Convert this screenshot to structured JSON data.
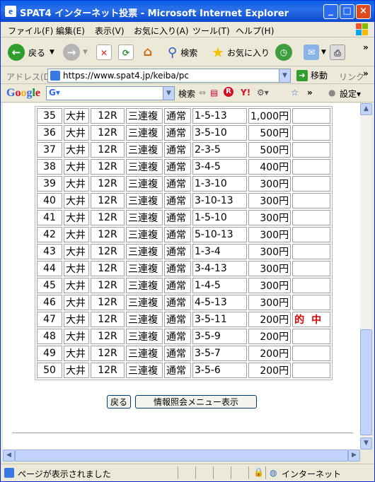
{
  "window": {
    "title": "SPAT4 インターネット投票 - Microsoft Internet Explorer"
  },
  "menu": [
    "ファイル(F)",
    "編集(E)",
    "表示(V)",
    "お気に入り(A)",
    "ツール(T)",
    "ヘルプ(H)"
  ],
  "toolbar": {
    "back": "戻る",
    "search": "検索",
    "favorites": "お気に入り"
  },
  "address": {
    "label": "アドレス(D)",
    "url": "https://www.spat4.jp/keiba/pc",
    "go": "移動",
    "links": "リンク"
  },
  "google": {
    "search": "検索",
    "settings": "設定"
  },
  "bets": [
    {
      "no": "35",
      "venue": "大井",
      "race": "12R",
      "type": "三連複",
      "mode": "通常",
      "combo": "1-5-13",
      "amount": "1,000円",
      "result": ""
    },
    {
      "no": "36",
      "venue": "大井",
      "race": "12R",
      "type": "三連複",
      "mode": "通常",
      "combo": "3-5-10",
      "amount": "500円",
      "result": ""
    },
    {
      "no": "37",
      "venue": "大井",
      "race": "12R",
      "type": "三連複",
      "mode": "通常",
      "combo": "2-3-5",
      "amount": "500円",
      "result": ""
    },
    {
      "no": "38",
      "venue": "大井",
      "race": "12R",
      "type": "三連複",
      "mode": "通常",
      "combo": "3-4-5",
      "amount": "400円",
      "result": ""
    },
    {
      "no": "39",
      "venue": "大井",
      "race": "12R",
      "type": "三連複",
      "mode": "通常",
      "combo": "1-3-10",
      "amount": "300円",
      "result": ""
    },
    {
      "no": "40",
      "venue": "大井",
      "race": "12R",
      "type": "三連複",
      "mode": "通常",
      "combo": "3-10-13",
      "amount": "300円",
      "result": ""
    },
    {
      "no": "41",
      "venue": "大井",
      "race": "12R",
      "type": "三連複",
      "mode": "通常",
      "combo": "1-5-10",
      "amount": "300円",
      "result": ""
    },
    {
      "no": "42",
      "venue": "大井",
      "race": "12R",
      "type": "三連複",
      "mode": "通常",
      "combo": "5-10-13",
      "amount": "300円",
      "result": ""
    },
    {
      "no": "43",
      "venue": "大井",
      "race": "12R",
      "type": "三連複",
      "mode": "通常",
      "combo": "1-3-4",
      "amount": "300円",
      "result": ""
    },
    {
      "no": "44",
      "venue": "大井",
      "race": "12R",
      "type": "三連複",
      "mode": "通常",
      "combo": "3-4-13",
      "amount": "300円",
      "result": ""
    },
    {
      "no": "45",
      "venue": "大井",
      "race": "12R",
      "type": "三連複",
      "mode": "通常",
      "combo": "1-4-5",
      "amount": "300円",
      "result": ""
    },
    {
      "no": "46",
      "venue": "大井",
      "race": "12R",
      "type": "三連複",
      "mode": "通常",
      "combo": "4-5-13",
      "amount": "300円",
      "result": ""
    },
    {
      "no": "47",
      "venue": "大井",
      "race": "12R",
      "type": "三連複",
      "mode": "通常",
      "combo": "3-5-11",
      "amount": "200円",
      "result": "的中"
    },
    {
      "no": "48",
      "venue": "大井",
      "race": "12R",
      "type": "三連複",
      "mode": "通常",
      "combo": "3-5-9",
      "amount": "200円",
      "result": ""
    },
    {
      "no": "49",
      "venue": "大井",
      "race": "12R",
      "type": "三連複",
      "mode": "通常",
      "combo": "3-5-7",
      "amount": "200円",
      "result": ""
    },
    {
      "no": "50",
      "venue": "大井",
      "race": "12R",
      "type": "三連複",
      "mode": "通常",
      "combo": "3-5-6",
      "amount": "200円",
      "result": ""
    }
  ],
  "buttons": {
    "back": "戻る",
    "menu": "情報照会メニュー表示"
  },
  "status": {
    "message": "ページが表示されました",
    "zone": "インターネット"
  },
  "colors": {
    "title_bar": "#0a5fe8",
    "hit_text": "#e00000",
    "chrome": "#ece9d8"
  }
}
